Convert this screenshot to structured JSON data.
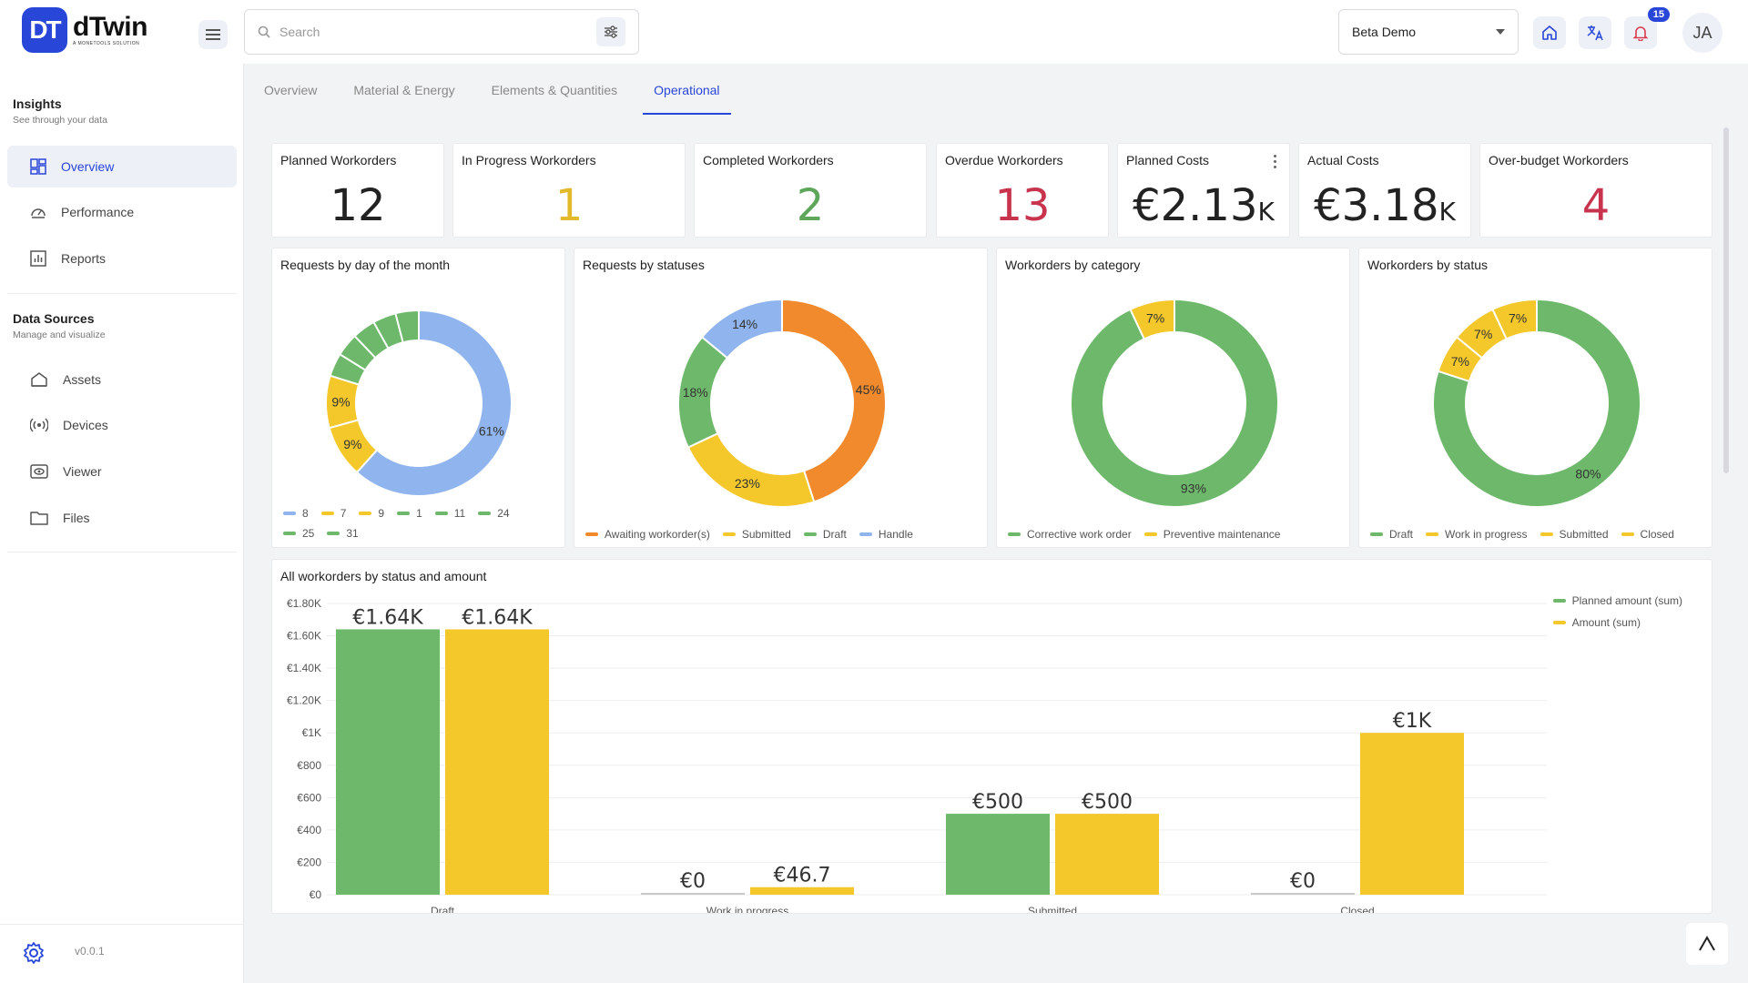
{
  "app": {
    "name": "dTwin",
    "tagline": "A MONETOOLS SOLUTION",
    "logo_glyph": "DT",
    "version": "v0.0.1"
  },
  "header": {
    "search_placeholder": "Search",
    "project": "Beta Demo",
    "notification_count": "15",
    "user_initials": "JA"
  },
  "sidebar": {
    "insights": {
      "title": "Insights",
      "subtitle": "See through your data",
      "items": [
        {
          "label": "Overview"
        },
        {
          "label": "Performance"
        },
        {
          "label": "Reports"
        }
      ]
    },
    "data_sources": {
      "title": "Data Sources",
      "subtitle": "Manage and visualize",
      "items": [
        {
          "label": "Assets"
        },
        {
          "label": "Devices"
        },
        {
          "label": "Viewer"
        },
        {
          "label": "Files"
        }
      ]
    }
  },
  "tabs": [
    {
      "label": "Overview"
    },
    {
      "label": "Material & Energy"
    },
    {
      "label": "Elements & Quantities"
    },
    {
      "label": "Operational"
    }
  ],
  "kpis": [
    {
      "title": "Planned Workorders",
      "value": "12",
      "unit": "",
      "color": "#222222"
    },
    {
      "title": "In Progress Workorders",
      "value": "1",
      "unit": "",
      "color": "#e3b92c"
    },
    {
      "title": "Completed Workorders",
      "value": "2",
      "unit": "",
      "color": "#5da65a"
    },
    {
      "title": "Overdue Workorders",
      "value": "13",
      "unit": "",
      "color": "#c8344e"
    },
    {
      "title": "Planned Costs",
      "value": "€2.13",
      "unit": "K",
      "color": "#222222"
    },
    {
      "title": "Actual Costs",
      "value": "€3.18",
      "unit": "K",
      "color": "#222222"
    },
    {
      "title": "Over-budget Workorders",
      "value": "4",
      "unit": "",
      "color": "#c8344e"
    }
  ],
  "colors": {
    "green": "#6db86a",
    "yellow": "#f4c72b",
    "orange": "#f08a2c",
    "blue": "#8fb4ee",
    "accent": "#2846d8"
  },
  "chart_data": [
    {
      "type": "pie",
      "title": "Requests by day of the month",
      "slices": [
        {
          "label": "8",
          "value": 61,
          "color": "#8fb4ee",
          "shown": "61%"
        },
        {
          "label": "7",
          "value": 9,
          "color": "#f4c72b",
          "shown": "9%"
        },
        {
          "label": "9",
          "value": 9,
          "color": "#f4c72b",
          "shown": "9%"
        },
        {
          "label": "1",
          "value": 4,
          "color": "#6db86a",
          "shown": ""
        },
        {
          "label": "11",
          "value": 4,
          "color": "#6db86a",
          "shown": ""
        },
        {
          "label": "24",
          "value": 4,
          "color": "#6db86a",
          "shown": ""
        },
        {
          "label": "25",
          "value": 4,
          "color": "#6db86a",
          "shown": ""
        },
        {
          "label": "31",
          "value": 4,
          "color": "#6db86a",
          "shown": ""
        }
      ]
    },
    {
      "type": "pie",
      "title": "Requests by statuses",
      "slices": [
        {
          "label": "Awaiting workorder(s)",
          "value": 45,
          "color": "#f08a2c",
          "shown": "45%"
        },
        {
          "label": "Submitted",
          "value": 23,
          "color": "#f4c72b",
          "shown": "23%"
        },
        {
          "label": "Draft",
          "value": 18,
          "color": "#6db86a",
          "shown": "18%"
        },
        {
          "label": "Handle",
          "value": 14,
          "color": "#8fb4ee",
          "shown": "14%"
        }
      ]
    },
    {
      "type": "pie",
      "title": "Workorders by category",
      "slices": [
        {
          "label": "Corrective work order",
          "value": 93,
          "color": "#6db86a",
          "shown": "93%"
        },
        {
          "label": "Preventive maintenance",
          "value": 7,
          "color": "#f4c72b",
          "shown": "7%"
        }
      ]
    },
    {
      "type": "pie",
      "title": "Workorders by status",
      "slices": [
        {
          "label": "Draft",
          "value": 80,
          "color": "#6db86a",
          "shown": "80%"
        },
        {
          "label": "Work in progress",
          "value": 6,
          "color": "#f4c72b",
          "shown": "7%"
        },
        {
          "label": "Submitted",
          "value": 7,
          "color": "#f4c72b",
          "shown": "7%"
        },
        {
          "label": "Closed",
          "value": 7,
          "color": "#f4c72b",
          "shown": "7%"
        }
      ]
    },
    {
      "type": "bar",
      "title": "All workorders by status and amount",
      "categories": [
        "Draft",
        "Work in progress",
        "Submitted",
        "Closed"
      ],
      "series": [
        {
          "name": "Planned amount (sum)",
          "values": [
            1640,
            0,
            500,
            0
          ],
          "labels": [
            "€1.64K",
            "€0",
            "€500",
            "€0"
          ],
          "color": "#6db86a"
        },
        {
          "name": "Amount (sum)",
          "values": [
            1640,
            46.7,
            500,
            1000
          ],
          "labels": [
            "€1.64K",
            "€46.7",
            "€500",
            "€1K"
          ],
          "color": "#f4c72b"
        }
      ],
      "ylim": [
        0,
        1800
      ],
      "yticks": [
        "€0",
        "€200",
        "€400",
        "€600",
        "€800",
        "€1K",
        "€1.20K",
        "€1.40K",
        "€1.60K",
        "€1.80K"
      ]
    }
  ]
}
